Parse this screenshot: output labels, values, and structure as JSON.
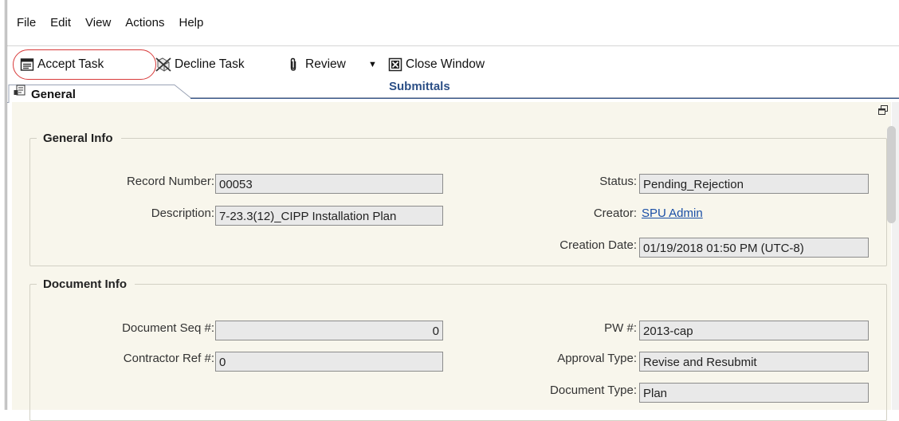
{
  "menu": {
    "items": [
      "File",
      "Edit",
      "View",
      "Actions",
      "Help"
    ]
  },
  "toolbar": {
    "accept_label": "Accept Task",
    "decline_label": "Decline Task",
    "review_label": "Review",
    "close_label": "Close Window"
  },
  "tabs": {
    "general_label": "General",
    "submittals_label": "Submittals"
  },
  "general_info": {
    "legend": "General Info",
    "record_number_label": "Record Number:",
    "record_number_value": "00053",
    "description_label": "Description:",
    "description_value": "7-23.3(12)_CIPP Installation Plan",
    "status_label": "Status:",
    "status_value": "Pending_Rejection",
    "creator_label": "Creator:",
    "creator_value": "SPU Admin",
    "creation_date_label": "Creation Date:",
    "creation_date_value": "01/19/2018 01:50 PM (UTC-8)"
  },
  "document_info": {
    "legend": "Document Info",
    "doc_seq_label": "Document Seq #:",
    "doc_seq_value": "0",
    "contractor_ref_label": "Contractor Ref #:",
    "contractor_ref_value": "0",
    "pw_label": "PW #:",
    "pw_value": "2013-cap",
    "approval_type_label": "Approval Type:",
    "approval_type_value": "Revise and Resubmit",
    "document_type_label": "Document Type:",
    "document_type_value": "Plan"
  },
  "colors": {
    "accent_circle": "#d83a3a",
    "link": "#1a4fa6",
    "tab_title": "#2c4f86",
    "panel_bg": "#f8f6ec"
  }
}
